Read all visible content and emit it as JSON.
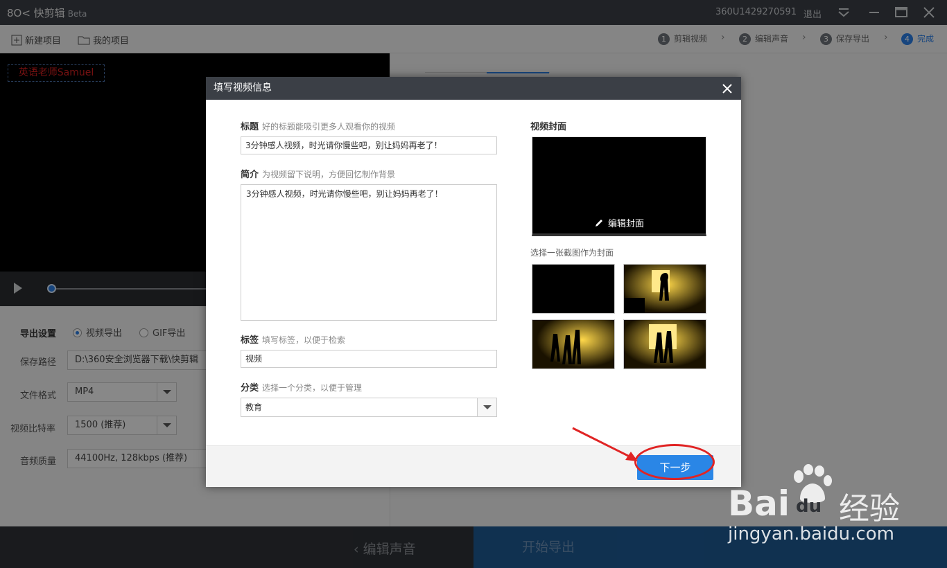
{
  "app": {
    "logo_text": "8O< 快剪辑",
    "beta": "Beta",
    "account": "360U1429270591",
    "logout": "退出"
  },
  "toolbar": {
    "new_project": "新建项目",
    "my_projects": "我的项目"
  },
  "steps": [
    {
      "num": "1",
      "label": "剪辑视频"
    },
    {
      "num": "2",
      "label": "编辑声音"
    },
    {
      "num": "3",
      "label": "保存导出"
    },
    {
      "num": "4",
      "label": "完成"
    }
  ],
  "preview": {
    "watermark": "英语老师Samuel",
    "progress": 0.0
  },
  "export_settings": {
    "heading": "导出设置",
    "radio_video": "视频导出",
    "radio_gif": "GIF导出",
    "path_label": "保存路径",
    "path_value": "D:\\360安全浏览器下载\\快剪辑",
    "format_label": "文件格式",
    "format_value": "MP4",
    "bitrate_label": "视频比特率",
    "bitrate_value": "1500 (推荐)",
    "audio_label": "音频质量",
    "audio_value": "44100Hz, 128kbps (推荐)"
  },
  "bottom": {
    "back": "编辑声音",
    "export": "开始导出"
  },
  "dialog": {
    "title": "填写视频信息",
    "title_label": "标题",
    "title_hint": "好的标题能吸引更多人观看你的视频",
    "title_value": "3分钟感人视频，时光请你慢些吧，别让妈妈再老了！",
    "desc_label": "简介",
    "desc_hint": "为视频留下说明，方便回忆制作背景",
    "desc_value": "3分钟感人视频，时光请你慢些吧，别让妈妈再老了！",
    "tags_label": "标签",
    "tags_hint": "填写标签，以便于检索",
    "tags_value": "视频",
    "category_label": "分类",
    "category_hint": "选择一个分类，以便于管理",
    "category_value": "教育",
    "cover_label": "视频封面",
    "edit_cover": "编辑封面",
    "choose_hint": "选择一张截图作为封面",
    "next": "下一步"
  },
  "watermark_baidu": {
    "brand": "Bai",
    "paw": "du",
    "cn": "经验",
    "url": "jingyan.baidu.com"
  },
  "colors": {
    "accent": "#2a86e6",
    "titlebar": "#3b3f46",
    "annotation": "#e02424"
  }
}
